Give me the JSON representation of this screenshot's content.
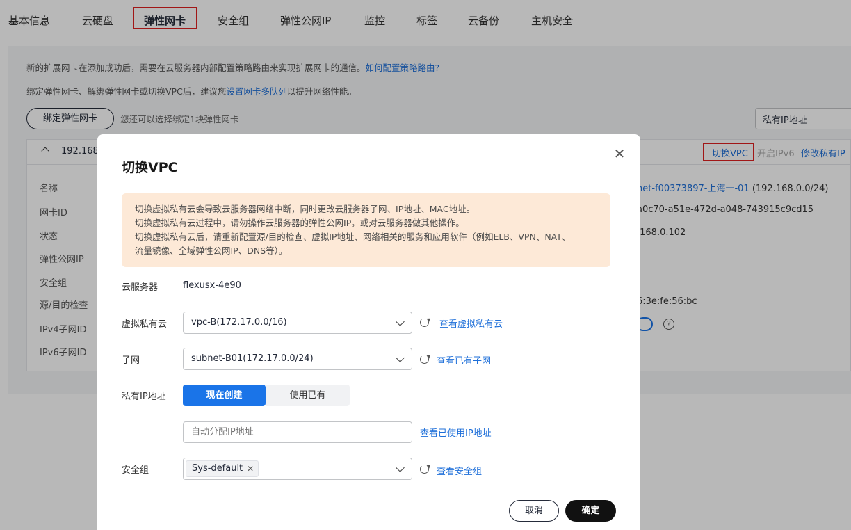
{
  "tabs": [
    "基本信息",
    "云硬盘",
    "弹性网卡",
    "安全组",
    "弹性公网IP",
    "监控",
    "标签",
    "云备份",
    "主机安全"
  ],
  "notice": {
    "line1": "新的扩展网卡在添加成功后，需要在云服务器内部配置策略路由来实现扩展网卡的通信。",
    "line1_link": "如何配置策略路由?",
    "line2_pre": "绑定弹性网卡、解绑弹性网卡或切换VPC后，建议您",
    "line2_link": "设置网卡多队列",
    "line2_post": "以提升网络性能。"
  },
  "bind_button": "绑定弹性网卡",
  "bind_hint": "您还可以选择绑定1块弹性网卡",
  "filter_select": "私有IP地址",
  "nic": {
    "ip": "192.168.",
    "actions": {
      "switch_vpc": "切换VPC",
      "ipv6": "开启IPv6",
      "modify_ip": "修改私有IP"
    },
    "fields": [
      "名称",
      "网卡ID",
      "状态",
      "弹性公网IP",
      "安全组",
      "源/目的检查",
      "IPv4子网ID",
      "IPv6子网ID"
    ],
    "subnet_link": "net-f00373897-上海一-01",
    "subnet_cidr": "(192.168.0.0/24)",
    "nic_id": "a0c70-a51e-472d-a048-743915c9cd15",
    "ip_tail": ".168.0.102",
    "mac_tail": "6:3e:fe:56:bc"
  },
  "dialog": {
    "title": "切换VPC",
    "warnings": [
      "切换虚拟私有云会导致云服务器网络中断，同时更改云服务器子网、IP地址、MAC地址。",
      "切换虚拟私有云过程中，请勿操作云服务器的弹性公网IP，或对云服务器做其他操作。",
      "切换虚拟私有云后，请重新配置源/目的检查、虚拟IP地址、网络相关的服务和应用软件（例如ELB、VPN、NAT、",
      "流量镜像、全域弹性公网IP、DNS等）。"
    ],
    "server_label": "云服务器",
    "server_value": "flexusx-4e90",
    "vpc_label": "虚拟私有云",
    "vpc_value": "vpc-B(172.17.0.0/16)",
    "vpc_link": "查看虚拟私有云",
    "subnet_label": "子网",
    "subnet_value": "subnet-B01(172.17.0.0/24)",
    "subnet_link": "查看已有子网",
    "ip_label": "私有IP地址",
    "ip_opt_new": "现在创建",
    "ip_opt_existing": "使用已有",
    "ip_placeholder": "自动分配IP地址",
    "ip_link": "查看已使用IP地址",
    "sg_label": "安全组",
    "sg_tag": "Sys-default",
    "sg_link": "查看安全组",
    "cancel": "取消",
    "confirm": "确定"
  }
}
